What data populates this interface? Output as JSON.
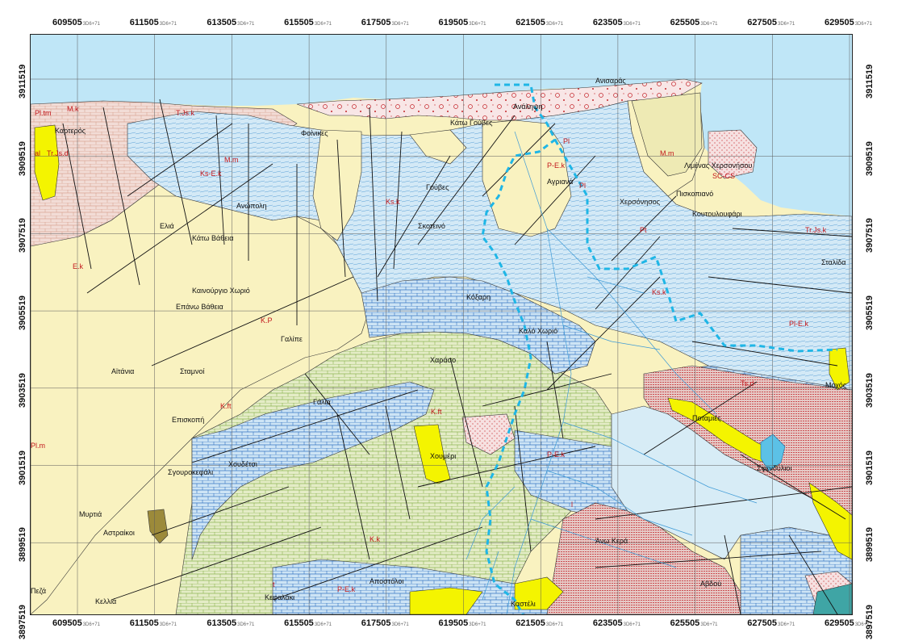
{
  "map": {
    "x_ticks": [
      "609505",
      "611505",
      "613505",
      "615505",
      "617505",
      "619505",
      "621505",
      "623505",
      "625505",
      "627505",
      "629505"
    ],
    "y_ticks": [
      "3911519",
      "3909519",
      "3907519",
      "3905519",
      "3903519",
      "3901519",
      "3899519",
      "3897519"
    ],
    "tick_suffix": "3D6+71",
    "colors": {
      "sea": "#bfe6f7",
      "pliocene": "#f9f2c0",
      "limestone_blue": "#cfe6f4",
      "limestone_green": "#e3ecc4",
      "pink": "#f2d6d2",
      "red_unit": "#e0c5c3",
      "alluvium": "#f4f400",
      "basin_boundary": "#1fb6e6"
    },
    "places": [
      "Κάτω Γούβες",
      "Ανάληψη",
      "Ανισαράς",
      "Λιμένας Χερσονήσου",
      "Χερσόνησος",
      "Πισκοπιανό",
      "Κουτουλουφάρι",
      "Σταλίδα",
      "Μοχός",
      "Ποταμιές",
      "Σφενδύλιοι",
      "Άνω Κερά",
      "Αβδού",
      "Καστέλι",
      "Αποστόλοι",
      "Κεφαλάκι",
      "Κελλιά",
      "Πεζά",
      "Μυρτιά",
      "Αστραίκοι",
      "Σγουροκεφάλι",
      "Χουδέτσι",
      "Επισκοπή",
      "Αϊτάνια",
      "Σταμνοί",
      "Γαλίπε",
      "Καινούργιο Χωριό",
      "Επάνω Βάθεια",
      "Κάτω Βάθεια",
      "Ανώπολη",
      "Ελιά",
      "Σκοτεινό",
      "Γούβες",
      "Αγριανά",
      "Κόξαρη",
      "Καλό Χωριό",
      "Χαράσο",
      "Γάλια",
      "Χουμέρι",
      "Φοίνικες",
      "Καρτερός"
    ],
    "codes": [
      "Pl.tm",
      "M.k",
      "T.Js.k",
      "Ks-E.k",
      "Pl",
      "M.m",
      "Pt",
      "SC-CS",
      "Ks.k",
      "K.ft",
      "K.k",
      "Pl.m",
      "al",
      "P-E.k",
      "t",
      "Tr.Js.k",
      "Pl-E.k",
      "l",
      "Tr.Js.d",
      "P-E.k",
      "Ts.d",
      "K.ft",
      "K.P",
      "Ks.k",
      "M.m",
      "E.k",
      "Pl",
      "P-E.k"
    ]
  }
}
